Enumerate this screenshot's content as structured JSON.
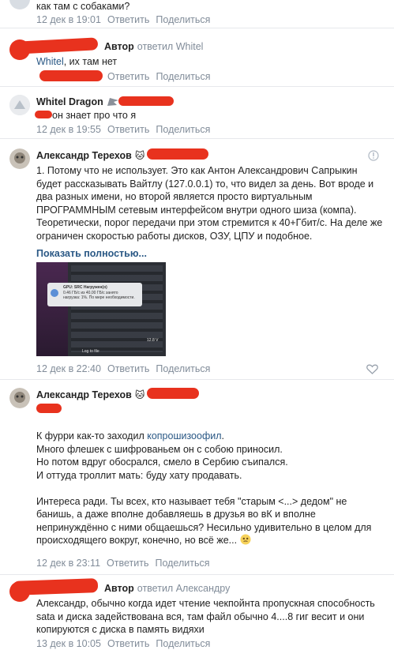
{
  "comments": [
    {
      "text": "как там с собаками?",
      "time": "12 дек в 19:01",
      "reply": "Ответить",
      "share": "Поделиться"
    },
    {
      "author_tag": "Автор",
      "reply_to": "ответил Whitel",
      "text_prefix": "Whitel",
      "text_rest": ", их там нет",
      "reply": "Ответить",
      "share": "Поделиться"
    },
    {
      "author": "Whitel Dragon",
      "text": "он знает про что я",
      "time": "12 дек в 19:55",
      "reply": "Ответить",
      "share": "Поделиться"
    },
    {
      "author": "Александр Терехов",
      "text": "1. Потому что не использует. Это как Антон Александрович Сапрыкин будет рассказывать Вайтлу (127.0.0.1) то, что видел за день. Вот вроде и два разных имени, но второй является просто виртуальным ПРОГРАММНЫМ сетевым интерфейсом внутри одного шиза (компа). Теоретически, порог передачи при этом стремится к 40+Гбит/с. На деле же ограничен скоростью работы дисков, ОЗУ, ЦПУ и подобное.",
      "show_more": "Показать полностью...",
      "image": {
        "popup_title": "GPU: SRC Нагружен(о)",
        "popup_line1": "0.46 ГБ/с из 40,00 ГБ/с занято",
        "popup_line2": "нагрузка: 1%. По мере необходимости.",
        "value": "12.8 V",
        "footer": "Log to file"
      },
      "time": "12 дек в 22:40",
      "reply": "Ответить",
      "share": "Поделиться"
    },
    {
      "author": "Александр Терехов",
      "text_before_link": "К фурри как-то заходил ",
      "link": "копрошизоофил",
      "text_after_link": ".\nМного флешек с шифрованьем он с собою приносил.\nНо потом вдруг обосрался, смело в Сербию съипался.\nИ оттуда троллит мать: буду хату продавать.\n\nИнтереса ради. Ты всех, кто называет тебя \"старым <...> дедом\" не банишь, а даже вполне добавляешь в друзья во вК и вполне непринуждённо с ними общаешься? Несильно удивительно в целом для происходящего вокруг, конечно, но всё же...",
      "time": "12 дек в 23:11",
      "reply": "Ответить",
      "share": "Поделиться"
    },
    {
      "author_tag": "Автор",
      "reply_to": "ответил Александру",
      "text": "Александр, обычно когда идет чтение чекпойнта пропускная способность sata и диска задействована вся, там файл обычно 4....8 гиг весит и они копируются с диска в память видяхи",
      "time": "13 дек в 10:05",
      "reply": "Ответить",
      "share": "Поделиться"
    }
  ],
  "colors": {
    "link": "#2a5885",
    "meta": "#818c99",
    "redaction": "#e8321e"
  }
}
